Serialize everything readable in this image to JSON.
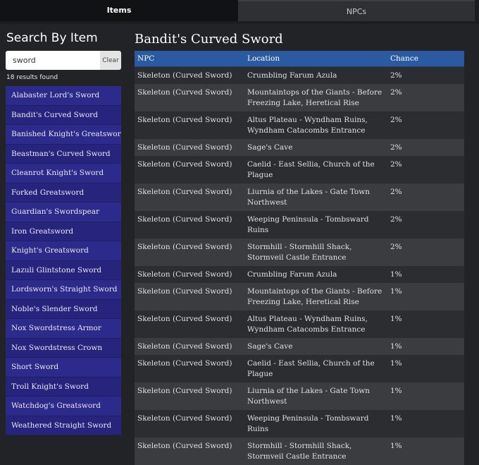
{
  "tabs": [
    {
      "label": "Items",
      "active": true
    },
    {
      "label": "NPCs",
      "active": false
    }
  ],
  "sidebar": {
    "title": "Search By Item",
    "search": {
      "value": "sword",
      "clear_label": "Clear"
    },
    "results_text": "18 results found",
    "items": [
      "Alabaster Lord's Sword",
      "Bandit's Curved Sword",
      "Banished Knight's Greatsword",
      "Beastman's Curved Sword",
      "Cleanrot Knight's Sword",
      "Forked Greatsword",
      "Guardian's Swordspear",
      "Iron Greatsword",
      "Knight's Greatsword",
      "Lazuli Glintstone Sword",
      "Lordsworn's Straight Sword",
      "Noble's Slender Sword",
      "Nox Swordstress Armor",
      "Nox Swordstress Crown",
      "Short Sword",
      "Troll Knight's Sword",
      "Watchdog's Greatsword",
      "Weathered Straight Sword"
    ]
  },
  "main": {
    "title": "Bandit's Curved Sword",
    "columns": [
      "NPC",
      "Location",
      "Chance"
    ],
    "rows": [
      [
        "Skeleton (Curved Sword)",
        "Crumbling Farum Azula",
        "2%"
      ],
      [
        "Skeleton (Curved Sword)",
        "Mountaintops of the Giants - Before Freezing Lake, Heretical Rise",
        "2%"
      ],
      [
        "Skeleton (Curved Sword)",
        "Altus Plateau - Wyndham Ruins, Wyndham Catacombs Entrance",
        "2%"
      ],
      [
        "Skeleton (Curved Sword)",
        "Sage's Cave",
        "2%"
      ],
      [
        "Skeleton (Curved Sword)",
        "Caelid - East Sellia, Church of the Plague",
        "2%"
      ],
      [
        "Skeleton (Curved Sword)",
        "Liurnia of the Lakes - Gate Town Northwest",
        "2%"
      ],
      [
        "Skeleton (Curved Sword)",
        "Weeping Peninsula - Tombsward Ruins",
        "2%"
      ],
      [
        "Skeleton (Curved Sword)",
        "Stormhill - Stormhill Shack, Stormveil Castle Entrance",
        "2%"
      ],
      [
        "Skeleton (Curved Sword)",
        "Crumbling Farum Azula",
        "1%"
      ],
      [
        "Skeleton (Curved Sword)",
        "Mountaintops of the Giants - Before Freezing Lake, Heretical Rise",
        "1%"
      ],
      [
        "Skeleton (Curved Sword)",
        "Altus Plateau - Wyndham Ruins, Wyndham Catacombs Entrance",
        "1%"
      ],
      [
        "Skeleton (Curved Sword)",
        "Sage's Cave",
        "1%"
      ],
      [
        "Skeleton (Curved Sword)",
        "Caelid - East Sellia, Church of the Plague",
        "1%"
      ],
      [
        "Skeleton (Curved Sword)",
        "Liurnia of the Lakes - Gate Town Northwest",
        "1%"
      ],
      [
        "Skeleton (Curved Sword)",
        "Weeping Peninsula - Tombsward Ruins",
        "1%"
      ],
      [
        "Skeleton (Curved Sword)",
        "Stormhill - Stormhill Shack, Stormveil Castle Entrance",
        "1%"
      ]
    ]
  },
  "colors": {
    "header_blue": "#2c5aa0",
    "list_purple": "#2c2a8a",
    "background": "#212326"
  }
}
